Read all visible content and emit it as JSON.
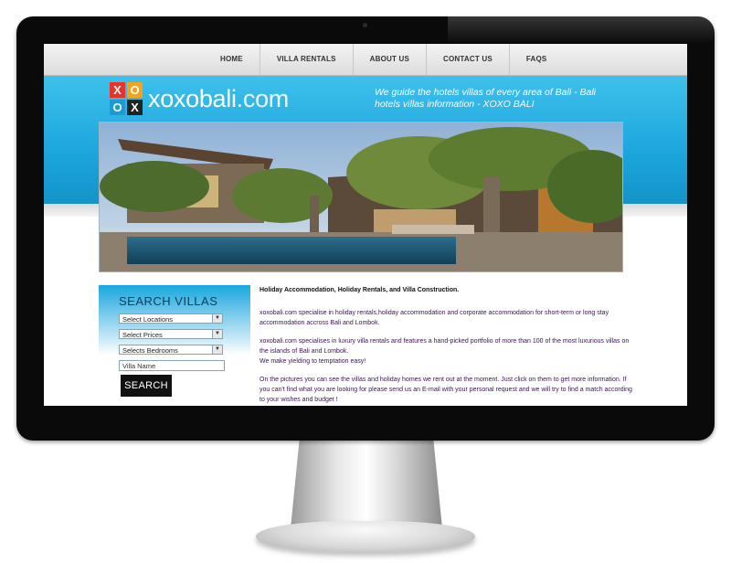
{
  "nav": {
    "items": [
      "HOME",
      "VILLA RENTALS",
      "ABOUT US",
      "CONTACT US",
      "FAQS"
    ]
  },
  "logo": {
    "letters": [
      "X",
      "O",
      "O",
      "X"
    ],
    "letter_colors": [
      "#e8332a",
      "#f6a21c",
      "#1b9ad6",
      "#222222"
    ],
    "site_name_main": "xoxobali",
    "site_name_tld": ".com"
  },
  "header": {
    "tagline": "We guide the hotels villas of every area of Bali - Bali hotels villas information - XOXO BALI"
  },
  "search": {
    "title": "SEARCH VILLAS",
    "locations": "Select Locations",
    "prices": "Select Prices",
    "bedrooms": "Selects Bedrooms",
    "villa_name_placeholder": "Villa Name",
    "button": "SEARCH"
  },
  "content": {
    "heading": "Holiday Accommodation, Holiday Rentals, and Villa Construction.",
    "p1": "xoxobali.com specialise in holiday rentals,holiday accommodation and corporate accommodation for short-term or long stay accommodation accross Bali and Lombok.",
    "p2": "xoxobali.com specialises in luxury villa rentals and features a hand-picked portfolio of more than 100 of the most luxurious villas on the islands of Bali and Lombok.",
    "p2b": "We make yielding to temptation easy!",
    "p3": "On the pictures you can see the villas and holiday homes we rent out at the moment. Just click on them to get more information. If you can't find what you are looking for please send us an E-mail with your personal request and we will try to find a match according to your wishes and budget !"
  },
  "colors": {
    "header_blue": "#1ca6dc",
    "bezel": "#0a0a0a"
  }
}
